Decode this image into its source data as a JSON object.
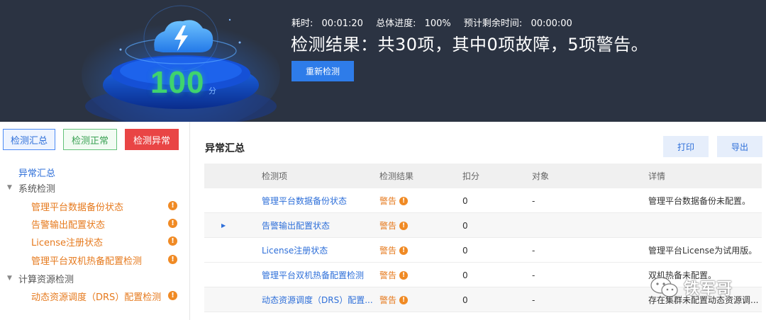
{
  "header": {
    "score": "100",
    "score_unit": "分",
    "elapsed_label": "耗时:",
    "elapsed_value": "00:01:20",
    "progress_label": "总体进度:",
    "progress_value": "100%",
    "remaining_label": "预计剩余时间:",
    "remaining_value": "00:00:00",
    "result_title": "检测结果：共30项，其中0项故障，5项警告。",
    "retest_label": "重新检测"
  },
  "sidebar": {
    "tabs": {
      "summary": "检测汇总",
      "normal": "检测正常",
      "abnormal": "检测异常"
    },
    "root": "异常汇总",
    "groups": [
      {
        "label": "系统检测",
        "items": [
          {
            "label": "管理平台数据备份状态"
          },
          {
            "label": "告警输出配置状态"
          },
          {
            "label": "License注册状态"
          },
          {
            "label": "管理平台双机热备配置检测"
          }
        ]
      },
      {
        "label": "计算资源检测",
        "items": [
          {
            "label": "动态资源调度（DRS）配置检测"
          }
        ]
      }
    ],
    "warn_glyph": "!"
  },
  "main": {
    "title": "异常汇总",
    "print_label": "打印",
    "export_label": "导出",
    "columns": {
      "item": "检测项",
      "result": "检测结果",
      "score": "扣分",
      "object": "对象",
      "detail": "详情"
    },
    "rows": [
      {
        "item": "管理平台数据备份状态",
        "result": "警告",
        "score": "0",
        "object": "-",
        "detail": "管理平台数据备份未配置。"
      },
      {
        "item": "告警输出配置状态",
        "result": "警告",
        "score": "0",
        "object": "",
        "detail": ""
      },
      {
        "item": "License注册状态",
        "result": "警告",
        "score": "0",
        "object": "-",
        "detail": "管理平台License为试用版。"
      },
      {
        "item": "管理平台双机热备配置检测",
        "result": "警告",
        "score": "0",
        "object": "-",
        "detail": "双机热备未配置。"
      },
      {
        "item": "动态资源调度（DRS）配置...",
        "result": "警告",
        "score": "0",
        "object": "-",
        "detail": "存在集群未配置动态资源调..."
      }
    ]
  },
  "watermark": {
    "text": "铁军哥"
  },
  "colors": {
    "header_bg": "#2b3342",
    "accent_blue": "#2e7ce9",
    "warning_orange": "#f08a24",
    "danger_red": "#e94545",
    "success_green": "#3fd36e"
  }
}
